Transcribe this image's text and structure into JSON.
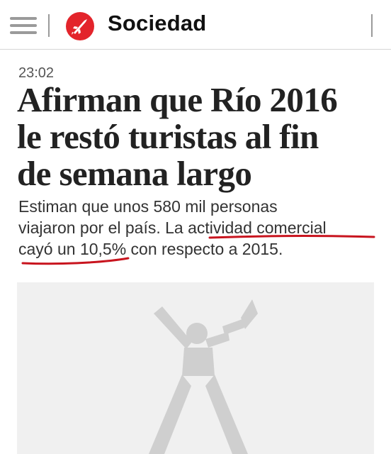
{
  "header": {
    "menu_icon": "hamburger-menu-icon",
    "logo_icon": "rocket-logo-icon",
    "section_title": "Sociedad",
    "accent_color": "#e3242b"
  },
  "article": {
    "time": "23:02",
    "headline_lines": [
      "Afirman que Río 2016",
      "le restó turistas al fin",
      "de semana largo"
    ],
    "summary_lines": [
      "Estiman que unos 580 mil personas",
      "viajaron por el país. La actividad comercial",
      "cayó un 10,5% con respecto a 2015."
    ],
    "annotation_color": "#c8141e",
    "placeholder_icon": "trumpet-player-placeholder-icon"
  }
}
